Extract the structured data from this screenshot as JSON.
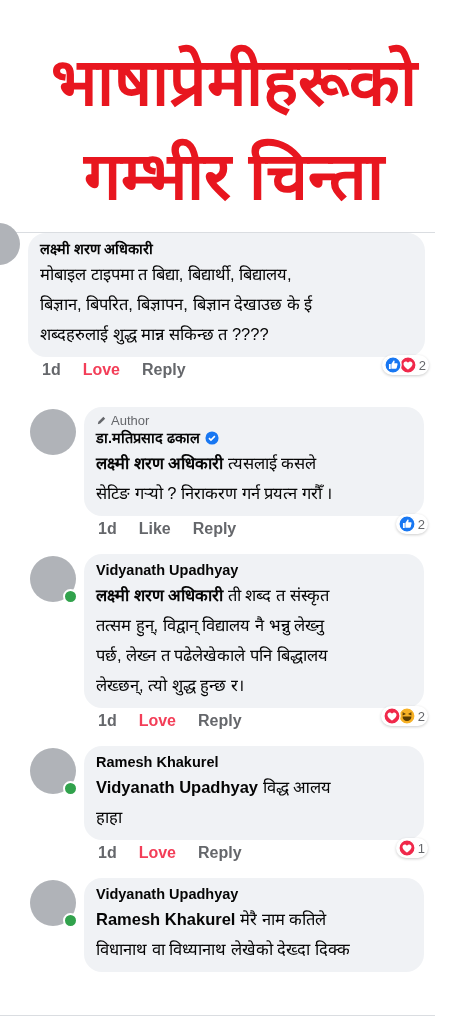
{
  "headline": {
    "lines": [
      "भाषाप्रेमीहरूको",
      "गम्भीर चिन्ता"
    ]
  },
  "comments": [
    {
      "author": "लक्ष्मी शरण अधिकारी",
      "online": false,
      "verified": false,
      "text": "मोबाइल टाइपमा त बिद्या, बिद्यार्थी, बिद्यालय,\nबिज्ञान, बिपरित, बिज्ञापन, बिज्ञान देखाउछ के ई\nशब्दहरुलाई शुद्ध मान्न सकिन्छ त ????",
      "time": "1d",
      "action": {
        "label": "Love",
        "kind": "love"
      },
      "reply": "Reply",
      "reactions": [
        {
          "kind": "like"
        },
        {
          "kind": "love"
        }
      ],
      "reaction_count": "2",
      "children": [
        {
          "badge": "Author",
          "author": "डा.मतिप्रसाद ढकाल",
          "online": false,
          "verified": true,
          "text": "**लक्ष्मी शरण अधिकारी** त्यसलाई कसले\nसेटिङ गर्‍यो ? निराकरण गर्न प्रयत्न गरौँ  ।",
          "time": "1d",
          "action": {
            "label": "Like",
            "kind": "none"
          },
          "reply": "Reply",
          "reactions": [
            {
              "kind": "like"
            }
          ],
          "reaction_count": "2"
        },
        {
          "author": "Vidyanath Upadhyay",
          "online": true,
          "verified": false,
          "text": "**लक्ष्मी शरण अधिकारी** ती शब्द त संस्कृत\nतत्सम हुन्, विद्वान् विद्यालय नै भन्नु लेख्नु\nपर्छ, लेख्न त पढेलेखेकाले पनि बिद्धालय\nलेख्छन्, त्यो शुद्ध हुन्छ र।",
          "time": "1d",
          "action": {
            "label": "Love",
            "kind": "love"
          },
          "reply": "Reply",
          "reactions": [
            {
              "kind": "love"
            },
            {
              "kind": "haha"
            }
          ],
          "reaction_count": "2"
        },
        {
          "author": "Ramesh Khakurel",
          "online": true,
          "verified": false,
          "text": "**Vidyanath Upadhyay** विद्ध आलय\nहाहा",
          "time": "1d",
          "action": {
            "label": "Love",
            "kind": "love"
          },
          "reply": "Reply",
          "reactions": [
            {
              "kind": "love"
            }
          ],
          "reaction_count": "1"
        },
        {
          "author": "Vidyanath Upadhyay",
          "online": true,
          "verified": false,
          "text": "**Ramesh Khakurel** मेरै नाम कतिले\nविधानाथ वा विध्यानाथ लेखेको देख्दा दिक्क"
        }
      ]
    }
  ]
}
